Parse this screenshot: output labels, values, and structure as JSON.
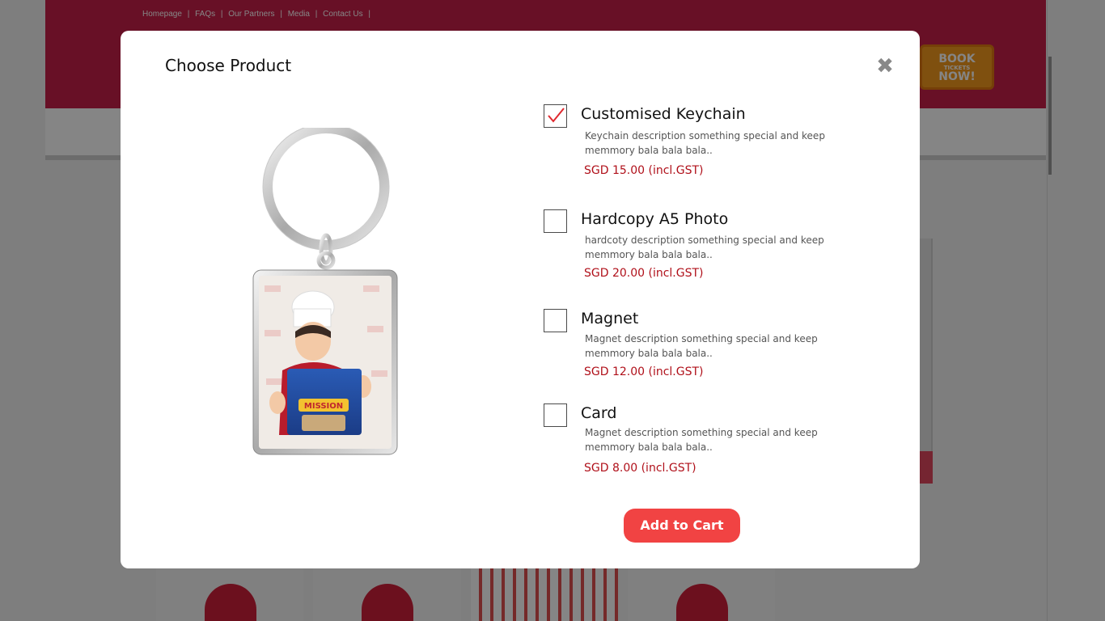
{
  "background": {
    "nav_links": [
      "Homepage",
      "|",
      "FAQs",
      "|",
      "Our Partners",
      "|",
      "Media",
      "|",
      "Contact Us",
      "|"
    ],
    "book_button": {
      "top": "BOOK",
      "small": "TICKETS",
      "bottom": "NOW!"
    }
  },
  "modal": {
    "title": "Choose Product",
    "close_label": "✖",
    "add_to_cart_label": "Add to Cart",
    "accent_color": "#f14343",
    "price_color": "#b0101a"
  },
  "products": [
    {
      "name": "Customised Keychain",
      "description": "Keychain description something special and keep memmory bala bala bala..",
      "price": "SGD 15.00 (incl.GST)",
      "checked": true
    },
    {
      "name": "Hardcopy A5 Photo",
      "description": "hardcoty description something special and keep memmory bala bala bala..",
      "price": "SGD 20.00 (incl.GST)",
      "checked": false
    },
    {
      "name": "Magnet",
      "description": "Magnet description something special and keep memmory bala bala bala..",
      "price": "SGD 12.00 (incl.GST)",
      "checked": false
    },
    {
      "name": "Card",
      "description": "Magnet description something special and keep memmory bala bala bala..",
      "price": "SGD 8.00 (incl.GST)",
      "checked": false
    }
  ],
  "preview": {
    "image_icon": "keychain-photo-icon",
    "photo_brand_text": "MISSION"
  }
}
